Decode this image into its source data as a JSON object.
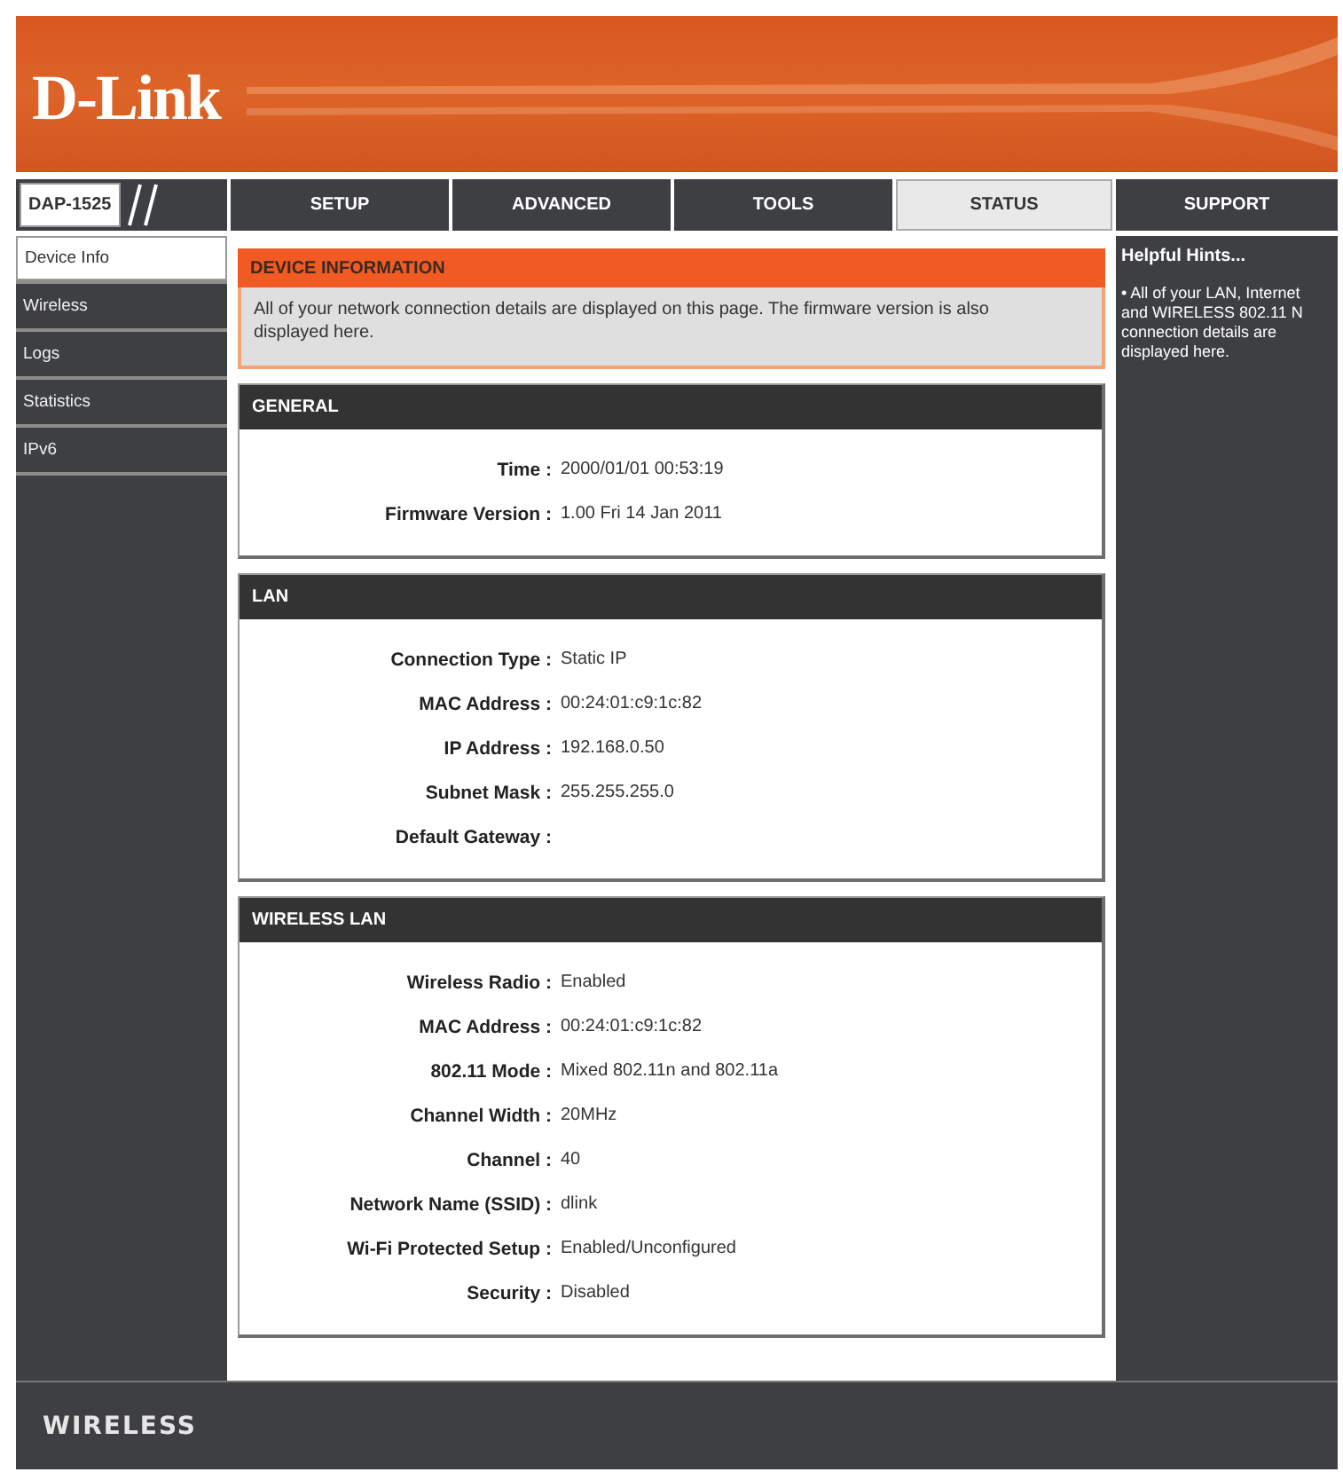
{
  "header": {
    "logo": "D-Link"
  },
  "nav": {
    "model": "DAP-1525",
    "tabs": [
      {
        "label": "SETUP",
        "selected": false
      },
      {
        "label": "ADVANCED",
        "selected": false
      },
      {
        "label": "TOOLS",
        "selected": false
      },
      {
        "label": "STATUS",
        "selected": true
      },
      {
        "label": "SUPPORT",
        "selected": false
      }
    ]
  },
  "sidebar": {
    "items": [
      {
        "label": "Device Info",
        "selected": true
      },
      {
        "label": "Wireless",
        "selected": false
      },
      {
        "label": "Logs",
        "selected": false
      },
      {
        "label": "Statistics",
        "selected": false
      },
      {
        "label": "IPv6",
        "selected": false
      }
    ]
  },
  "intro": {
    "title": "DEVICE INFORMATION",
    "text": "All of your network connection details are displayed on this page. The firmware version is also displayed here."
  },
  "sections": [
    {
      "title": "GENERAL",
      "rows": [
        {
          "label": "Time :",
          "value": "2000/01/01 00:53:19"
        },
        {
          "label": "Firmware Version :",
          "value": "1.00 Fri 14 Jan 2011"
        }
      ]
    },
    {
      "title": "LAN",
      "rows": [
        {
          "label": "Connection Type :",
          "value": "Static IP"
        },
        {
          "label": "MAC Address :",
          "value": "00:24:01:c9:1c:82"
        },
        {
          "label": "IP Address :",
          "value": "192.168.0.50"
        },
        {
          "label": "Subnet Mask :",
          "value": "255.255.255.0"
        },
        {
          "label": "Default Gateway :"
        }
      ]
    },
    {
      "title": "WIRELESS LAN",
      "rows": [
        {
          "label": "Wireless Radio :",
          "value": "Enabled"
        },
        {
          "label": "MAC Address :",
          "value": "00:24:01:c9:1c:82"
        },
        {
          "label": "802.11 Mode :",
          "value": "Mixed 802.11n and 802.11a"
        },
        {
          "label": "Channel Width :",
          "value": "20MHz"
        },
        {
          "label": "Channel :",
          "value": "40"
        },
        {
          "label": "Network Name (SSID) :",
          "value": "dlink"
        },
        {
          "label": "Wi-Fi Protected Setup :",
          "value": "Enabled/Unconfigured"
        },
        {
          "label": "Security :",
          "value": "Disabled"
        }
      ]
    }
  ],
  "hints": {
    "title": "Helpful Hints...",
    "items": [
      "• All of your LAN, Internet and WIRELESS 802.11 N connection details are displayed here."
    ]
  },
  "footer": {
    "brand": "WIRELESS"
  }
}
